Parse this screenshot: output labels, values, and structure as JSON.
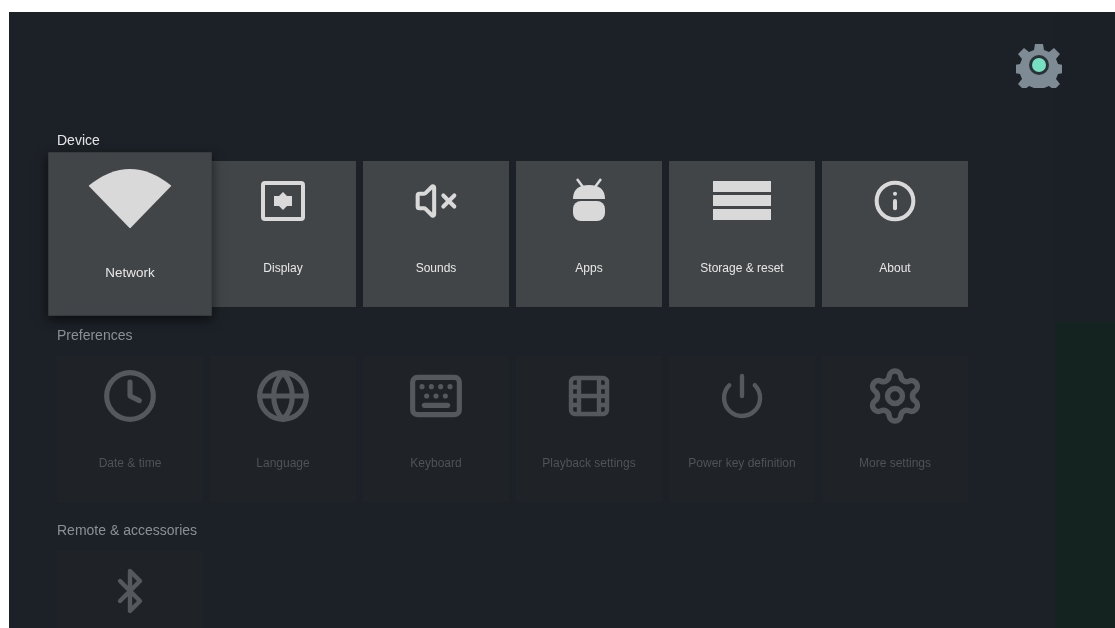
{
  "sections": [
    {
      "title": "Device",
      "focused": true,
      "items": [
        {
          "label": "Network",
          "selected": true
        },
        {
          "label": "Display",
          "selected": false
        },
        {
          "label": "Sounds",
          "selected": false
        },
        {
          "label": "Apps",
          "selected": false
        },
        {
          "label": "Storage & reset",
          "selected": false
        },
        {
          "label": "About",
          "selected": false
        }
      ]
    },
    {
      "title": "Preferences",
      "focused": false,
      "items": [
        {
          "label": "Date & time",
          "selected": false
        },
        {
          "label": "Language",
          "selected": false
        },
        {
          "label": "Keyboard",
          "selected": false
        },
        {
          "label": "Playback settings",
          "selected": false
        },
        {
          "label": "Power key definition",
          "selected": false
        },
        {
          "label": "More settings",
          "selected": false
        }
      ]
    },
    {
      "title": "Remote & accessories",
      "focused": false,
      "items": [
        {
          "selected": false
        }
      ]
    }
  ]
}
